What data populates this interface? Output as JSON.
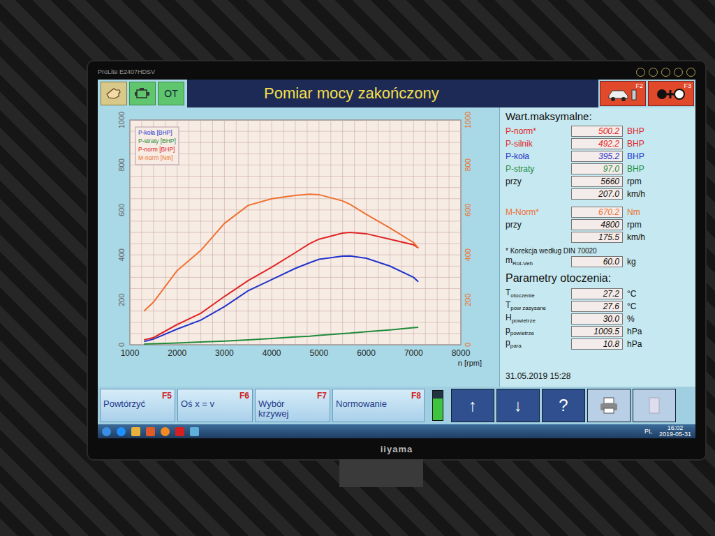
{
  "monitor": {
    "model": "ProLite E2407HDSV",
    "brand": "iiyama"
  },
  "header": {
    "mode_buttons": [
      {
        "kind": "hand",
        "label": "",
        "selected": true
      },
      {
        "kind": "engine",
        "label": "",
        "selected": false
      },
      {
        "kind": "text",
        "label": "OT",
        "selected": false
      }
    ],
    "title": "Pomiar mocy zakończony",
    "function_buttons": [
      {
        "key": "F2",
        "kind": "car"
      },
      {
        "key": "F3",
        "kind": "dots"
      }
    ]
  },
  "chart": {
    "legend": [
      "P-koła [BHP]",
      "P-straty [BHP]",
      "P-norm [BHP]",
      "M-norm [Nm]"
    ],
    "left_ticks": [
      "0",
      "200",
      "400",
      "600",
      "800",
      "1000"
    ],
    "right_ticks": [
      "0",
      "200",
      "400",
      "600",
      "800",
      "1000"
    ],
    "x_ticks": [
      "1000",
      "2000",
      "3000",
      "4000",
      "5000",
      "6000",
      "7000",
      "8000"
    ],
    "x_label": "n [rpm]",
    "x_values": [
      1300,
      1500,
      2000,
      2500,
      3000,
      3500,
      4000,
      4500,
      4800,
      5000,
      5500,
      5660,
      6000,
      6500,
      7000,
      7100
    ],
    "series": [
      {
        "name": "P-koła [BHP]",
        "color": "#2233cc",
        "values": [
          15,
          25,
          70,
          110,
          170,
          240,
          290,
          340,
          365,
          380,
          394,
          395,
          385,
          350,
          300,
          280
        ]
      },
      {
        "name": "P-straty [BHP]",
        "color": "#1f8a3a",
        "values": [
          3,
          5,
          8,
          12,
          16,
          22,
          28,
          35,
          38,
          42,
          50,
          52,
          58,
          66,
          76,
          78
        ]
      },
      {
        "name": "P-norm [BHP]",
        "color": "#e02424",
        "values": [
          22,
          32,
          90,
          140,
          215,
          285,
          345,
          410,
          450,
          470,
          497,
          500,
          494,
          470,
          445,
          430
        ]
      },
      {
        "name": "M-norm [Nm]",
        "color": "#f07030",
        "values": [
          150,
          190,
          330,
          420,
          540,
          620,
          650,
          665,
          670,
          668,
          640,
          625,
          580,
          520,
          455,
          430
        ]
      }
    ]
  },
  "maxima": {
    "title": "Wart.maksymalne:",
    "rows": [
      {
        "label": "P-norm*",
        "value": "500.2",
        "unit": "BHP",
        "color": "#e02424"
      },
      {
        "label": "P-silnik",
        "value": "492.2",
        "unit": "BHP",
        "color": "#e02424"
      },
      {
        "label": "P-koła",
        "value": "395.2",
        "unit": "BHP",
        "color": "#2233cc"
      },
      {
        "label": "P-straty",
        "value": "97.0",
        "unit": "BHP",
        "color": "#1f8a3a"
      },
      {
        "label": "przy",
        "value": "5660",
        "unit": "rpm",
        "color": "#111111"
      },
      {
        "label": "",
        "value": "207.0",
        "unit": "km/h",
        "color": "#111111"
      },
      {
        "label": "M-Norm*",
        "value": "670.2",
        "unit": "Nm",
        "color": "#f07030"
      },
      {
        "label": "przy",
        "value": "4800",
        "unit": "rpm",
        "color": "#111111"
      },
      {
        "label": "",
        "value": "175.5",
        "unit": "km/h",
        "color": "#111111"
      }
    ],
    "note": "* Korekcja według DIN 70020",
    "mass": {
      "label": "m",
      "sub": "Rot-Veh",
      "value": "60.0",
      "unit": "kg"
    }
  },
  "ambient": {
    "title": "Parametry otoczenia:",
    "rows": [
      {
        "label": "T",
        "sub": "otoczenie",
        "value": "27.2",
        "unit": "°C"
      },
      {
        "label": "T",
        "sub": "pow zasysane",
        "value": "27.6",
        "unit": "°C"
      },
      {
        "label": "H",
        "sub": "powietrze",
        "value": "30.0",
        "unit": "%"
      },
      {
        "label": "p",
        "sub": "powietrze",
        "value": "1009.5",
        "unit": "hPa"
      },
      {
        "label": "p",
        "sub": "para",
        "value": "10.8",
        "unit": "hPa"
      }
    ]
  },
  "timestamp": "31.05.2019 15:28",
  "bottom_buttons": [
    {
      "label": "Powtórzyć",
      "key": "F5"
    },
    {
      "label": "Oś x = v",
      "key": "F6"
    },
    {
      "label": "Wybór krzywej",
      "key": "F7"
    },
    {
      "label": "Normowanie",
      "key": "F8"
    }
  ],
  "status_indicator": {
    "level": 0.75
  },
  "nav_buttons": [
    {
      "kind": "text",
      "label": "↑"
    },
    {
      "kind": "text",
      "label": "↓"
    },
    {
      "kind": "text",
      "label": "?"
    },
    {
      "kind": "print",
      "label": ""
    },
    {
      "kind": "blank",
      "label": ""
    }
  ],
  "taskbar": {
    "apps": [
      {
        "kind": "start"
      },
      {
        "kind": "ie"
      },
      {
        "kind": "folder"
      },
      {
        "kind": "media"
      },
      {
        "kind": "firefox"
      },
      {
        "kind": "pdf"
      },
      {
        "kind": "app"
      }
    ],
    "language": "PL",
    "time": "16:02",
    "date": "2019-05-31"
  }
}
